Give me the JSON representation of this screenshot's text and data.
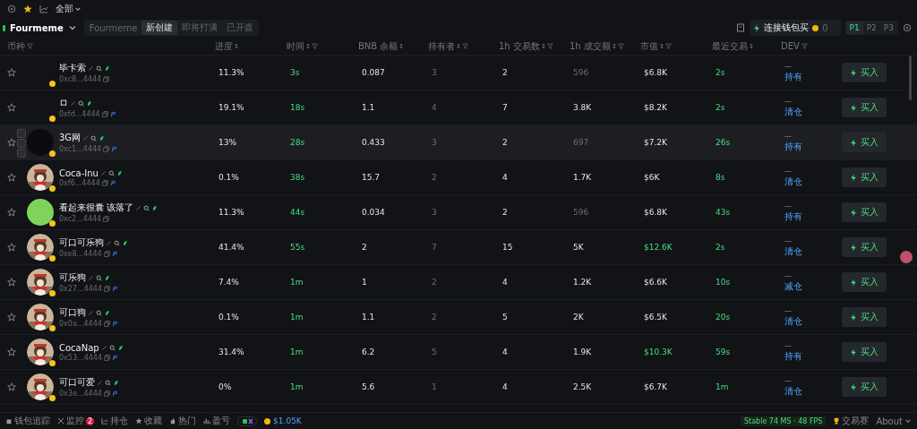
{
  "top_bar": {
    "filter": "全部"
  },
  "nav": {
    "title": "Fourmeme",
    "tabs": [
      {
        "label": "Fourmeme",
        "selected": false
      },
      {
        "label": "新创建",
        "selected": true
      },
      {
        "label": "即将打满",
        "selected": false
      },
      {
        "label": "已开盘",
        "selected": false
      }
    ],
    "connect_button": "连接钱包买",
    "coin_count": "0",
    "presets": [
      {
        "label": "P1",
        "selected": true
      },
      {
        "label": "P2",
        "selected": false
      },
      {
        "label": "P3",
        "selected": false
      }
    ]
  },
  "columns": [
    {
      "label": "币种",
      "sort": false,
      "filter": true
    },
    {
      "label": "进度",
      "sort": true,
      "filter": false
    },
    {
      "label": "时间",
      "sort": true,
      "filter": true
    },
    {
      "label": "BNB 余额",
      "sort": true,
      "filter": false
    },
    {
      "label": "持有者",
      "sort": true,
      "filter": true
    },
    {
      "label": "1h 交易数",
      "sort": true,
      "filter": true
    },
    {
      "label": "1h 成交额",
      "sort": true,
      "filter": true
    },
    {
      "label": "市值",
      "sort": true,
      "filter": true
    },
    {
      "label": "最近交易",
      "sort": true,
      "filter": false
    },
    {
      "label": "DEV",
      "sort": false,
      "filter": true
    }
  ],
  "rows": [
    {
      "name": "毕卡索",
      "address": "0xc8...4444",
      "kind": "none",
      "social": false,
      "hovered": false,
      "progress": "11.3%",
      "time": "3s",
      "bnb": "0.087",
      "holders": "3",
      "tx": "2",
      "volume": "596",
      "volume_dim": true,
      "mcap": "$6.8K",
      "mcap_high": false,
      "recent": "2s",
      "dev": "—",
      "dev_action": "持有",
      "buy": "买入"
    },
    {
      "name": "ロ",
      "address": "0xfd...4444",
      "kind": "none",
      "social": true,
      "hovered": false,
      "progress": "19.1%",
      "time": "18s",
      "bnb": "1.1",
      "holders": "4",
      "tx": "7",
      "volume": "3.8K",
      "volume_dim": false,
      "mcap": "$8.2K",
      "mcap_high": false,
      "recent": "2s",
      "dev": "—",
      "dev_action": "清仓",
      "buy": "买入"
    },
    {
      "name": "3G网",
      "address": "0xc1...4444",
      "kind": "dark",
      "social": true,
      "hovered": true,
      "progress": "13%",
      "time": "28s",
      "bnb": "0.433",
      "holders": "3",
      "tx": "2",
      "volume": "697",
      "volume_dim": true,
      "mcap": "$7.2K",
      "mcap_high": false,
      "recent": "26s",
      "dev": "—",
      "dev_action": "持有",
      "buy": "买入"
    },
    {
      "name": "Coca-Inu",
      "address": "0xf6...4444",
      "kind": "picture",
      "social": true,
      "hovered": false,
      "progress": "0.1%",
      "time": "38s",
      "bnb": "15.7",
      "holders": "2",
      "tx": "4",
      "volume": "1.7K",
      "volume_dim": false,
      "mcap": "$6K",
      "mcap_high": false,
      "recent": "8s",
      "dev": "—",
      "dev_action": "清仓",
      "buy": "买入"
    },
    {
      "name": "看起来很囊 该落了",
      "address": "0xc2...4444",
      "kind": "green",
      "social": false,
      "hovered": false,
      "progress": "11.3%",
      "time": "44s",
      "bnb": "0.034",
      "holders": "3",
      "tx": "2",
      "volume": "596",
      "volume_dim": true,
      "mcap": "$6.8K",
      "mcap_high": false,
      "recent": "43s",
      "dev": "—",
      "dev_action": "持有",
      "buy": "买入"
    },
    {
      "name": "可口可乐狗",
      "address": "0xe8...4444",
      "kind": "picture",
      "social": true,
      "hovered": false,
      "progress": "41.4%",
      "time": "55s",
      "bnb": "2",
      "holders": "7",
      "tx": "15",
      "volume": "5K",
      "volume_dim": false,
      "mcap": "$12.6K",
      "mcap_high": true,
      "recent": "2s",
      "dev": "—",
      "dev_action": "清仓",
      "buy": "买入"
    },
    {
      "name": "可乐狗",
      "address": "0x27...4444",
      "kind": "picture",
      "social": true,
      "hovered": false,
      "progress": "7.4%",
      "time": "1m",
      "bnb": "1",
      "holders": "2",
      "tx": "4",
      "volume": "1.2K",
      "volume_dim": false,
      "mcap": "$6.6K",
      "mcap_high": false,
      "recent": "10s",
      "dev": "—",
      "dev_action": "减仓",
      "buy": "买入"
    },
    {
      "name": "可口狗",
      "address": "0x0a...4444",
      "kind": "picture",
      "social": true,
      "hovered": false,
      "progress": "0.1%",
      "time": "1m",
      "bnb": "1.1",
      "holders": "2",
      "tx": "5",
      "volume": "2K",
      "volume_dim": false,
      "mcap": "$6.5K",
      "mcap_high": false,
      "recent": "20s",
      "dev": "—",
      "dev_action": "清仓",
      "buy": "买入"
    },
    {
      "name": "CocaNap",
      "address": "0x53...4444",
      "kind": "picture",
      "social": true,
      "hovered": false,
      "progress": "31.4%",
      "time": "1m",
      "bnb": "6.2",
      "holders": "5",
      "tx": "4",
      "volume": "1.9K",
      "volume_dim": false,
      "mcap": "$10.3K",
      "mcap_high": true,
      "recent": "59s",
      "dev": "—",
      "dev_action": "持有",
      "buy": "买入"
    },
    {
      "name": "可口可爱",
      "address": "0x3e...4444",
      "kind": "picture",
      "social": true,
      "hovered": false,
      "progress": "0%",
      "time": "1m",
      "bnb": "5.6",
      "holders": "1",
      "tx": "4",
      "volume": "2.5K",
      "volume_dim": false,
      "mcap": "$6.7K",
      "mcap_high": false,
      "recent": "1m",
      "dev": "—",
      "dev_action": "清仓",
      "buy": "买入"
    }
  ],
  "footer": {
    "items": [
      {
        "label": "钱包追踪"
      },
      {
        "label": "监控",
        "badge": "2"
      },
      {
        "label": "持仓"
      },
      {
        "label": "收藏"
      },
      {
        "label": "热门"
      },
      {
        "label": "盈亏"
      }
    ],
    "balance": "$1.05K",
    "status": "Stable 74 MS · 48 FPS",
    "contest": "交易赛",
    "about": "About"
  }
}
